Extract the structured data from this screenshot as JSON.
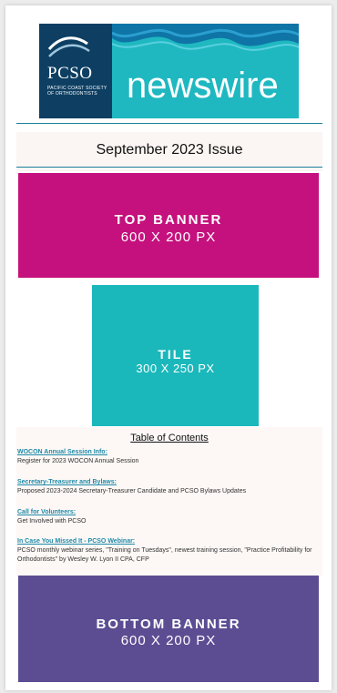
{
  "header": {
    "logo_abbrev": "PCSO",
    "logo_org": "PACIFIC COAST SOCIETY OF ORTHODONTISTS",
    "logo_word": "newswire"
  },
  "issue": {
    "title": "September 2023 Issue"
  },
  "top_banner": {
    "line1": "TOP BANNER",
    "line2": "600 X 200 PX",
    "color": "#c5117d"
  },
  "tile": {
    "line1": "TILE",
    "line2": "300 X 250 PX",
    "color": "#1bb8bb"
  },
  "toc": {
    "title": "Table of Contents",
    "items": [
      {
        "link": "WOCON Annual Session Info:",
        "desc": "Register for 2023 WOCON Annual Session"
      },
      {
        "link": "Secretary-Treasurer and Bylaws:",
        "desc": "Proposed 2023-2024 Secretary-Treasurer Candidate and PCSO Bylaws Updates"
      },
      {
        "link": "Call for Volunteers:",
        "desc": "Get Involved with PCSO"
      },
      {
        "link": "In Case You Missed It - PCSO Webinar:",
        "desc": "PCSO monthly webinar series, \"Training on Tuesdays\", newest training session, \"Practice Profitability for Orthodontists\" by Wesley W. Lyon II CPA, CFP"
      }
    ]
  },
  "bottom_banner": {
    "line1": "BOTTOM BANNER",
    "line2": "600 X 200 PX",
    "color": "#5c4d93"
  }
}
